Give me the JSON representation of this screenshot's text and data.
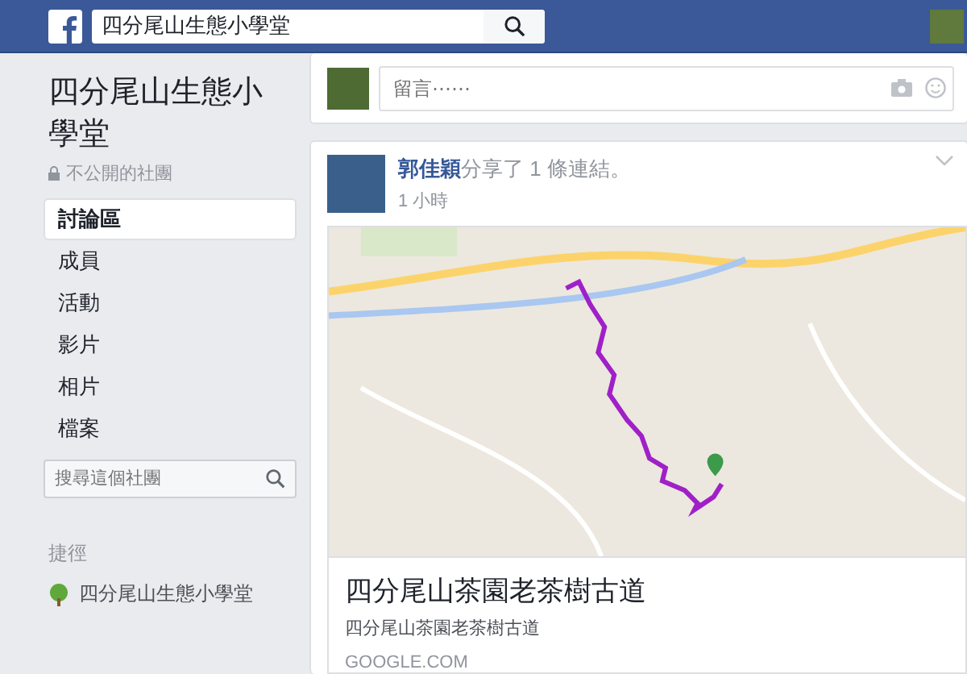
{
  "header": {
    "search_value": "四分尾山生態小學堂"
  },
  "group": {
    "name": "四分尾山生態小學堂",
    "privacy": "不公開的社團"
  },
  "nav": [
    {
      "label": "討論區",
      "selected": true
    },
    {
      "label": "成員",
      "selected": false
    },
    {
      "label": "活動",
      "selected": false
    },
    {
      "label": "影片",
      "selected": false
    },
    {
      "label": "相片",
      "selected": false
    },
    {
      "label": "檔案",
      "selected": false
    }
  ],
  "group_search": {
    "placeholder": "搜尋這個社團"
  },
  "shortcuts": {
    "title": "捷徑",
    "items": [
      "四分尾山生態小學堂"
    ]
  },
  "comment_box": {
    "placeholder": "留言⋯⋯"
  },
  "post": {
    "author": "郭佳穎",
    "action": "分享了 1 條連結。",
    "time": "1 小時",
    "link": {
      "title": "四分尾山茶園老茶樹古道",
      "description": "四分尾山茶園老茶樹古道",
      "domain": "GOOGLE.COM"
    }
  }
}
